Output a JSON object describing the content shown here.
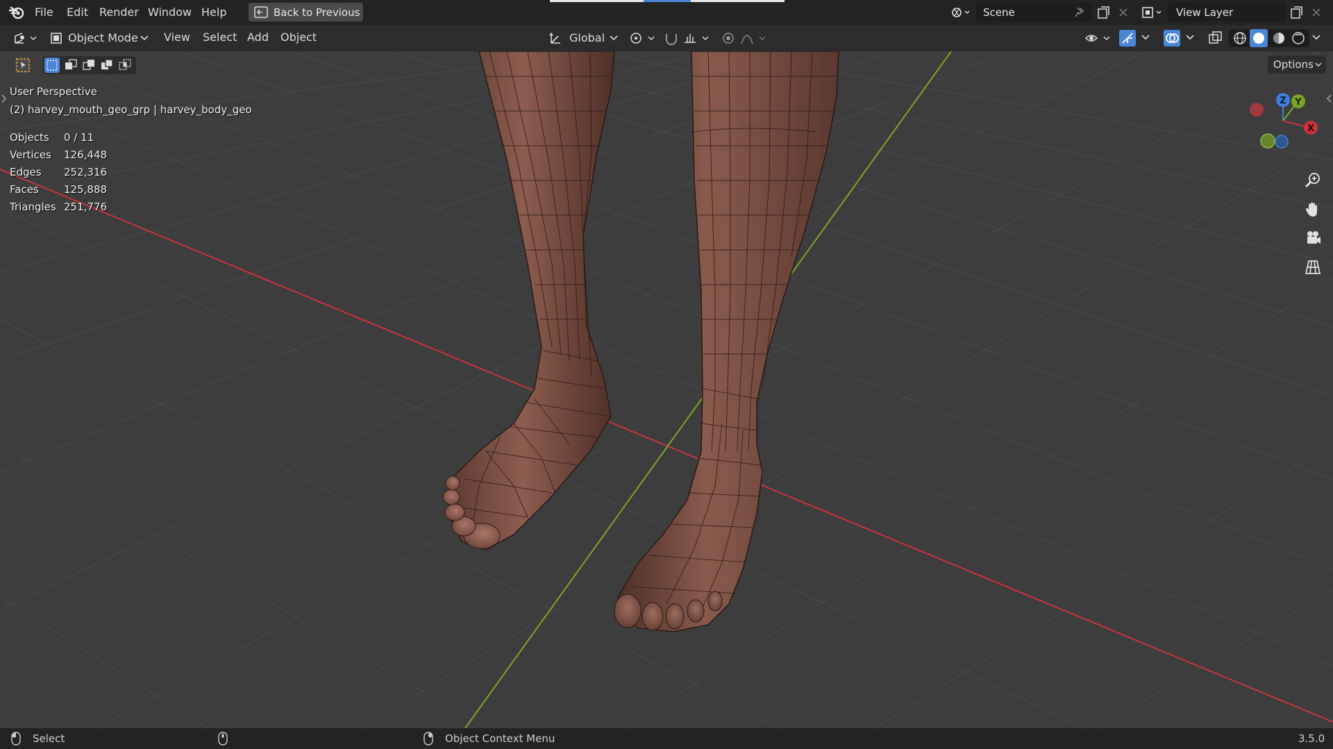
{
  "menu": {
    "file": "File",
    "edit": "Edit",
    "render": "Render",
    "window": "Window",
    "help": "Help",
    "back_to_previous": "Back to Previous"
  },
  "scene": {
    "label": "Scene"
  },
  "view_layer": {
    "label": "View Layer"
  },
  "header": {
    "mode": "Object Mode",
    "view": "View",
    "select": "Select",
    "add": "Add",
    "object": "Object",
    "transform_orientation": "Global",
    "options": "Options"
  },
  "viewport": {
    "perspective": "User Perspective",
    "active_object": "(2) harvey_mouth_geo_grp | harvey_body_geo",
    "stats": [
      {
        "label": "Objects",
        "value": "0 / 11"
      },
      {
        "label": "Vertices",
        "value": "126,448"
      },
      {
        "label": "Edges",
        "value": "252,316"
      },
      {
        "label": "Faces",
        "value": "125,888"
      },
      {
        "label": "Triangles",
        "value": "251,776"
      }
    ],
    "gizmo": {
      "z": "Z",
      "y": "Y",
      "x": "X"
    }
  },
  "status": {
    "select": "Select",
    "context_menu": "Object Context Menu",
    "version": "3.5.0"
  },
  "colors": {
    "x_axis": "#c8343f",
    "y_axis": "#7aa627",
    "z_axis": "#3f7fdc",
    "skin": "#8a5a4c",
    "accent": "#4a86d6"
  }
}
